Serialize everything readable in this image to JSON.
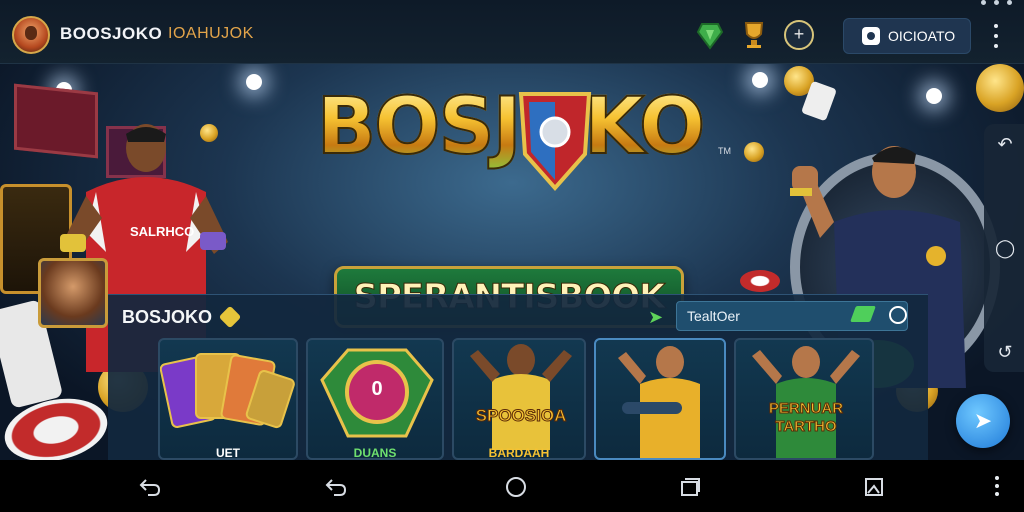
{
  "header": {
    "app_name": "BOOSJOKO",
    "tagline": "IOAHUJOK",
    "action_button_label": "OICIOATO",
    "icons": [
      "green-gem-icon",
      "gold-trophy-icon",
      "plus-circle-icon",
      "camera-icon",
      "more-vert-icon"
    ]
  },
  "hero": {
    "title": "BOSJOKO",
    "trademark": "TM",
    "banner": "SPERANTISBOOK",
    "left_jersey": "SALRHCO"
  },
  "games_panel": {
    "title": "BOSJOKO",
    "search_label": "TealtOer",
    "cards": [
      {
        "caption": "UET"
      },
      {
        "caption": "DUANS",
        "badge": "0"
      },
      {
        "caption": "BARDAAH",
        "title": "SPOOSIOA"
      },
      {
        "caption": ""
      },
      {
        "caption": "",
        "title": "PERNUAR TARTHO"
      }
    ]
  },
  "side_controls": [
    "rotate-icon",
    "refresh-icon",
    "reset-icon"
  ],
  "nav": [
    "back-icon",
    "back-alt-icon",
    "home-icon",
    "recents-icon",
    "screenshot-icon",
    "more-vert-icon"
  ],
  "colors": {
    "accent_gold": "#f6c232",
    "accent_green": "#1e7a3c",
    "panel_bg": "#12283e"
  }
}
